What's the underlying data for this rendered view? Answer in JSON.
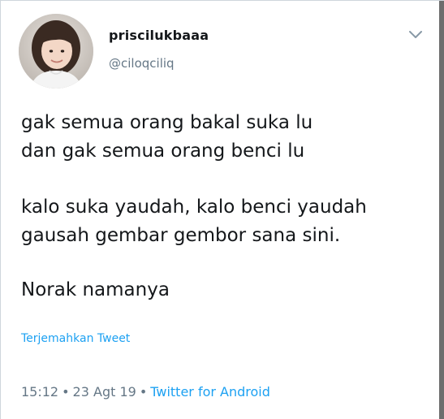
{
  "user": {
    "display_name": "priscilukbaaa",
    "handle": "@ciloqciliq"
  },
  "tweet": {
    "paragraphs": [
      "gak semua orang bakal suka lu\ndan gak semua orang benci lu",
      "kalo suka yaudah, kalo benci yaudah\ngausah gembar gembor sana sini.",
      "Norak namanya"
    ],
    "translate_label": "Terjemahkan Tweet",
    "time": "15:12",
    "date": "23 Agt 19",
    "source": "Twitter for Android",
    "separator": "•"
  },
  "icons": {
    "menu": "chevron-down-icon",
    "avatar": "profile-photo"
  },
  "colors": {
    "link": "#1da1f2",
    "secondary_text": "#657786",
    "primary_text": "#14171a"
  }
}
